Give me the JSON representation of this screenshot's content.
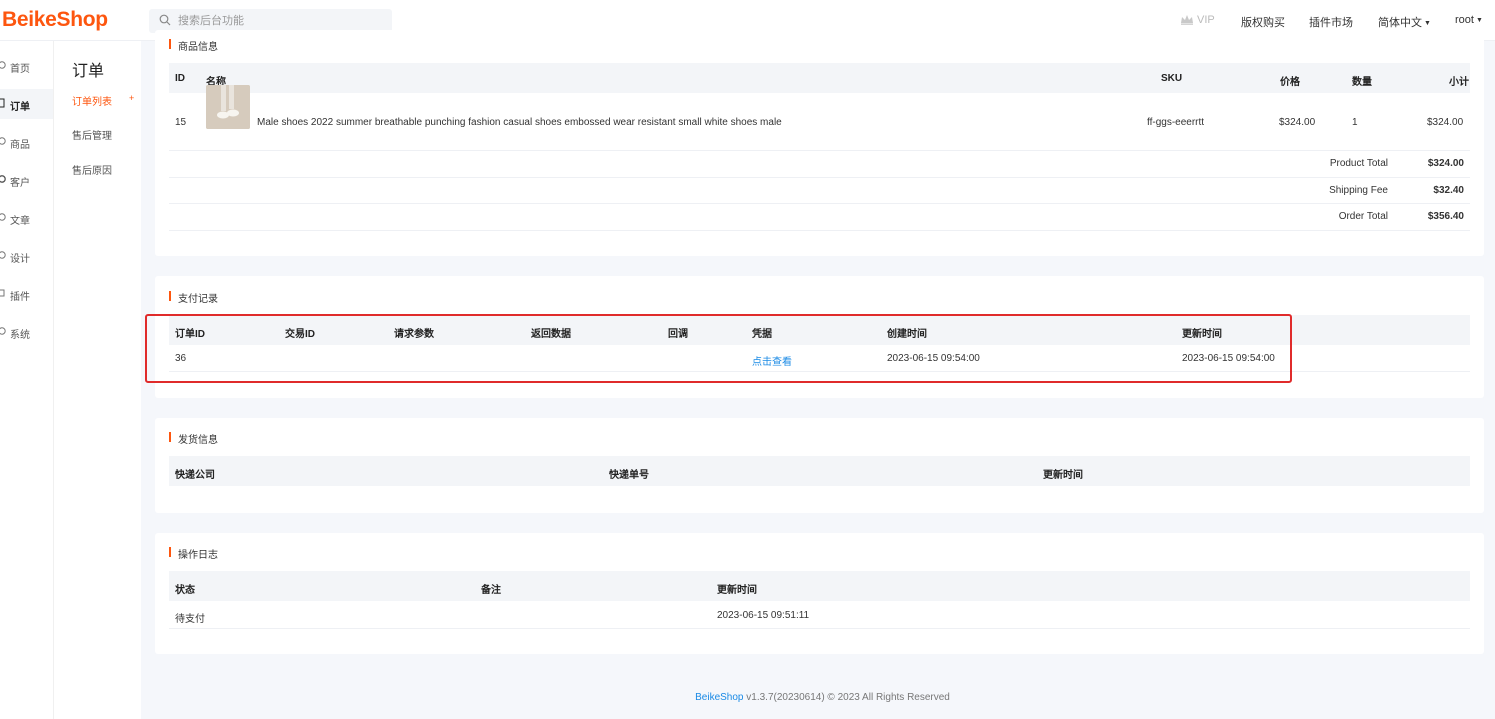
{
  "app": {
    "brand": "BeikeShop"
  },
  "search": {
    "placeholder": "搜索后台功能"
  },
  "topnav": {
    "vip": "VIP",
    "license": "版权购买",
    "plugins": "插件市场",
    "language": "简体中文",
    "user": "root"
  },
  "sidebar": {
    "items": [
      {
        "label": "首页",
        "icon": "home-icon"
      },
      {
        "label": "订单",
        "icon": "order-icon"
      },
      {
        "label": "商品",
        "icon": "product-icon"
      },
      {
        "label": "客户",
        "icon": "customer-icon"
      },
      {
        "label": "文章",
        "icon": "article-icon"
      },
      {
        "label": "设计",
        "icon": "design-icon"
      },
      {
        "label": "插件",
        "icon": "plugin-icon"
      },
      {
        "label": "系统",
        "icon": "system-icon"
      }
    ]
  },
  "subnav": {
    "title": "订单",
    "items": [
      "订单列表",
      "售后管理",
      "售后原因"
    ]
  },
  "products": {
    "title": "商品信息",
    "headers": {
      "id": "ID",
      "name": "名称",
      "sku": "SKU",
      "price": "价格",
      "qty": "数量",
      "subtotal": "小计"
    },
    "row": {
      "id": "15",
      "name": "Male shoes 2022 summer breathable punching fashion casual shoes embossed wear resistant small white shoes male",
      "sku": "ff-ggs-eeerrtt",
      "price": "$324.00",
      "qty": "1",
      "subtotal": "$324.00"
    },
    "totals": [
      {
        "label": "Product Total",
        "value": "$324.00"
      },
      {
        "label": "Shipping Fee",
        "value": "$32.40"
      },
      {
        "label": "Order Total",
        "value": "$356.40"
      }
    ]
  },
  "payments": {
    "title": "支付记录",
    "headers": {
      "order_id": "订单ID",
      "transaction_id": "交易ID",
      "request": "请求参数",
      "response": "返回数据",
      "callback": "回调",
      "receipt": "凭据",
      "created": "创建时间",
      "updated": "更新时间"
    },
    "row": {
      "order_id": "36",
      "receipt": "点击查看",
      "created": "2023-06-15 09:54:00",
      "updated": "2023-06-15 09:54:00"
    }
  },
  "shipping": {
    "title": "发货信息",
    "headers": {
      "company": "快递公司",
      "number": "快递单号",
      "updated": "更新时间"
    }
  },
  "logs": {
    "title": "操作日志",
    "headers": {
      "status": "状态",
      "note": "备注",
      "updated": "更新时间"
    },
    "row": {
      "status": "待支付",
      "note": "",
      "updated": "2023-06-15 09:51:11"
    }
  },
  "footer": {
    "brand": "BeikeShop",
    "text": " v1.3.7(20230614) © 2023 All Rights Reserved"
  },
  "colors": {
    "accent": "#fd560f",
    "link": "#1a8ae5",
    "highlight": "#e02b2b"
  }
}
